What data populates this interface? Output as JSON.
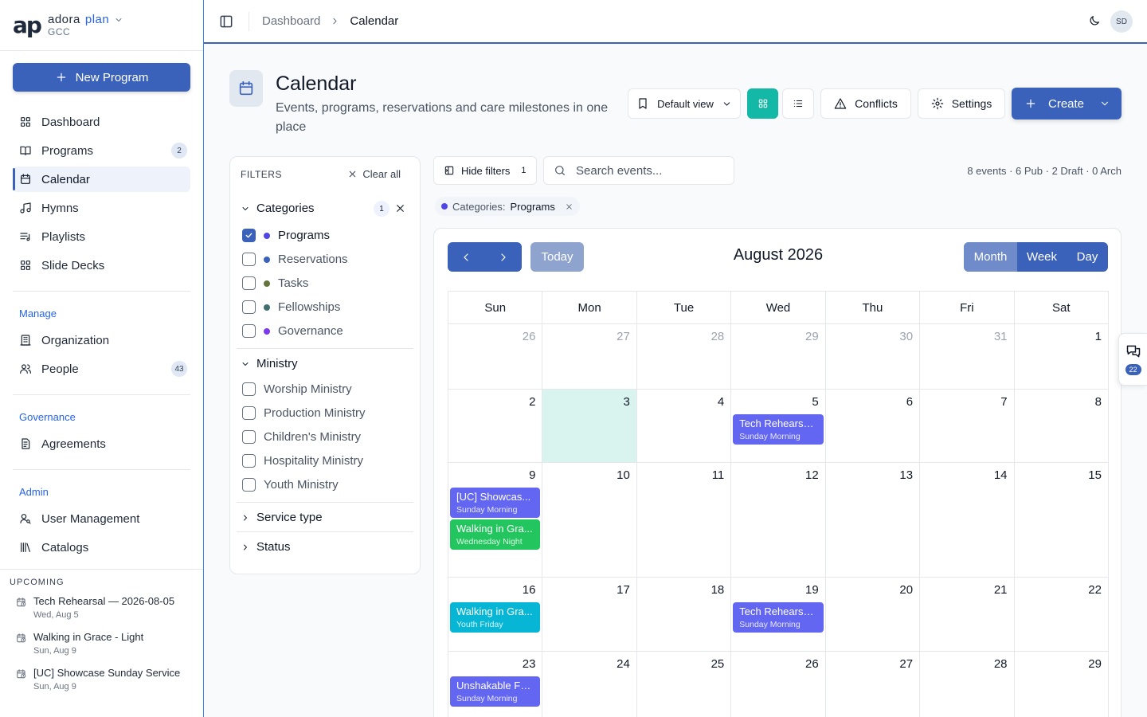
{
  "brand": {
    "logo": "ap",
    "name_a": "adora",
    "name_b": "plan",
    "org": "GCC"
  },
  "sidebar": {
    "new_program": "New Program",
    "main": [
      {
        "label": "Dashboard",
        "icon": "grid-icon"
      },
      {
        "label": "Programs",
        "icon": "book-icon",
        "badge": "2"
      },
      {
        "label": "Calendar",
        "icon": "calendar-icon",
        "active": true
      },
      {
        "label": "Hymns",
        "icon": "music-icon"
      },
      {
        "label": "Playlists",
        "icon": "playlist-icon"
      },
      {
        "label": "Slide Decks",
        "icon": "grid-icon"
      }
    ],
    "manage_title": "Manage",
    "manage": [
      {
        "label": "Organization",
        "icon": "building-icon"
      },
      {
        "label": "People",
        "icon": "users-icon",
        "badge": "43"
      }
    ],
    "governance_title": "Governance",
    "governance": [
      {
        "label": "Agreements",
        "icon": "document-icon"
      }
    ],
    "admin_title": "Admin",
    "admin": [
      {
        "label": "User Management",
        "icon": "user-key-icon"
      },
      {
        "label": "Catalogs",
        "icon": "library-icon"
      }
    ],
    "upcoming_title": "UPCOMING",
    "upcoming": [
      {
        "title": "Tech Rehearsal — 2026-08-05",
        "date": "Wed, Aug 5"
      },
      {
        "title": "Walking in Grace - Light",
        "date": "Sun, Aug 9"
      },
      {
        "title": "[UC] Showcase Sunday Service",
        "date": "Sun, Aug 9"
      }
    ]
  },
  "topbar": {
    "crumb_root": "Dashboard",
    "crumb_current": "Calendar",
    "avatar": "SD"
  },
  "header": {
    "title": "Calendar",
    "subtitle": "Events, programs, reservations and care milestones in one place",
    "default_view": "Default view",
    "conflicts": "Conflicts",
    "settings": "Settings",
    "create": "Create"
  },
  "filters": {
    "title": "FILTERS",
    "clear": "Clear all",
    "categories_title": "Categories",
    "categories_count": "1",
    "categories": [
      {
        "label": "Programs",
        "color": "#4f46e5",
        "checked": true
      },
      {
        "label": "Reservations",
        "color": "#3b62ba",
        "checked": false
      },
      {
        "label": "Tasks",
        "color": "#65743a",
        "checked": false
      },
      {
        "label": "Fellowships",
        "color": "#3f6f6f",
        "checked": false
      },
      {
        "label": "Governance",
        "color": "#7c3aed",
        "checked": false
      }
    ],
    "ministry_title": "Ministry",
    "ministries": [
      "Worship Ministry",
      "Production Ministry",
      "Children's Ministry",
      "Hospitality Ministry",
      "Youth Ministry"
    ],
    "service_type": "Service type",
    "status": "Status"
  },
  "toolbar": {
    "hide_filters": "Hide filters",
    "hide_count": "1",
    "search_placeholder": "Search events...",
    "stats": "8 events · 6 Pub · 2 Draft · 0 Arch",
    "chip_key": "Categories:",
    "chip_value": "Programs"
  },
  "calendar": {
    "today": "Today",
    "month_title": "August 2026",
    "views": [
      "Month",
      "Week",
      "Day"
    ],
    "active_view": "Month",
    "weekdays": [
      "Sun",
      "Mon",
      "Tue",
      "Wed",
      "Thu",
      "Fri",
      "Sat"
    ],
    "weeks": [
      [
        {
          "d": "26",
          "other": true
        },
        {
          "d": "27",
          "other": true
        },
        {
          "d": "28",
          "other": true
        },
        {
          "d": "29",
          "other": true
        },
        {
          "d": "30",
          "other": true
        },
        {
          "d": "31",
          "other": true
        },
        {
          "d": "1"
        }
      ],
      [
        {
          "d": "2"
        },
        {
          "d": "3",
          "today": true
        },
        {
          "d": "4"
        },
        {
          "d": "5",
          "events": [
            {
              "title": "Tech Rehearsa...",
              "sub": "Sunday Morning",
              "color": "#6366f1"
            }
          ]
        },
        {
          "d": "6"
        },
        {
          "d": "7"
        },
        {
          "d": "8"
        }
      ],
      [
        {
          "d": "9",
          "events": [
            {
              "title": "[UC] Showcas...",
              "sub": "Sunday Morning",
              "color": "#6366f1"
            },
            {
              "title": "Walking in Gra...",
              "sub": "Wednesday Night",
              "color": "#22c55e"
            }
          ]
        },
        {
          "d": "10"
        },
        {
          "d": "11"
        },
        {
          "d": "12"
        },
        {
          "d": "13"
        },
        {
          "d": "14"
        },
        {
          "d": "15"
        }
      ],
      [
        {
          "d": "16",
          "events": [
            {
              "title": "Walking in Gra...",
              "sub": "Youth Friday",
              "color": "#06b6d4"
            }
          ]
        },
        {
          "d": "17"
        },
        {
          "d": "18"
        },
        {
          "d": "19",
          "events": [
            {
              "title": "Tech Rehearsa...",
              "sub": "Sunday Morning",
              "color": "#6366f1"
            }
          ]
        },
        {
          "d": "20"
        },
        {
          "d": "21"
        },
        {
          "d": "22"
        }
      ],
      [
        {
          "d": "23",
          "events": [
            {
              "title": "Unshakable Fa...",
              "sub": "Sunday Morning",
              "color": "#6366f1"
            }
          ]
        },
        {
          "d": "24"
        },
        {
          "d": "25"
        },
        {
          "d": "26"
        },
        {
          "d": "27"
        },
        {
          "d": "28"
        },
        {
          "d": "29"
        }
      ]
    ]
  },
  "side_widget": {
    "count": "22"
  }
}
